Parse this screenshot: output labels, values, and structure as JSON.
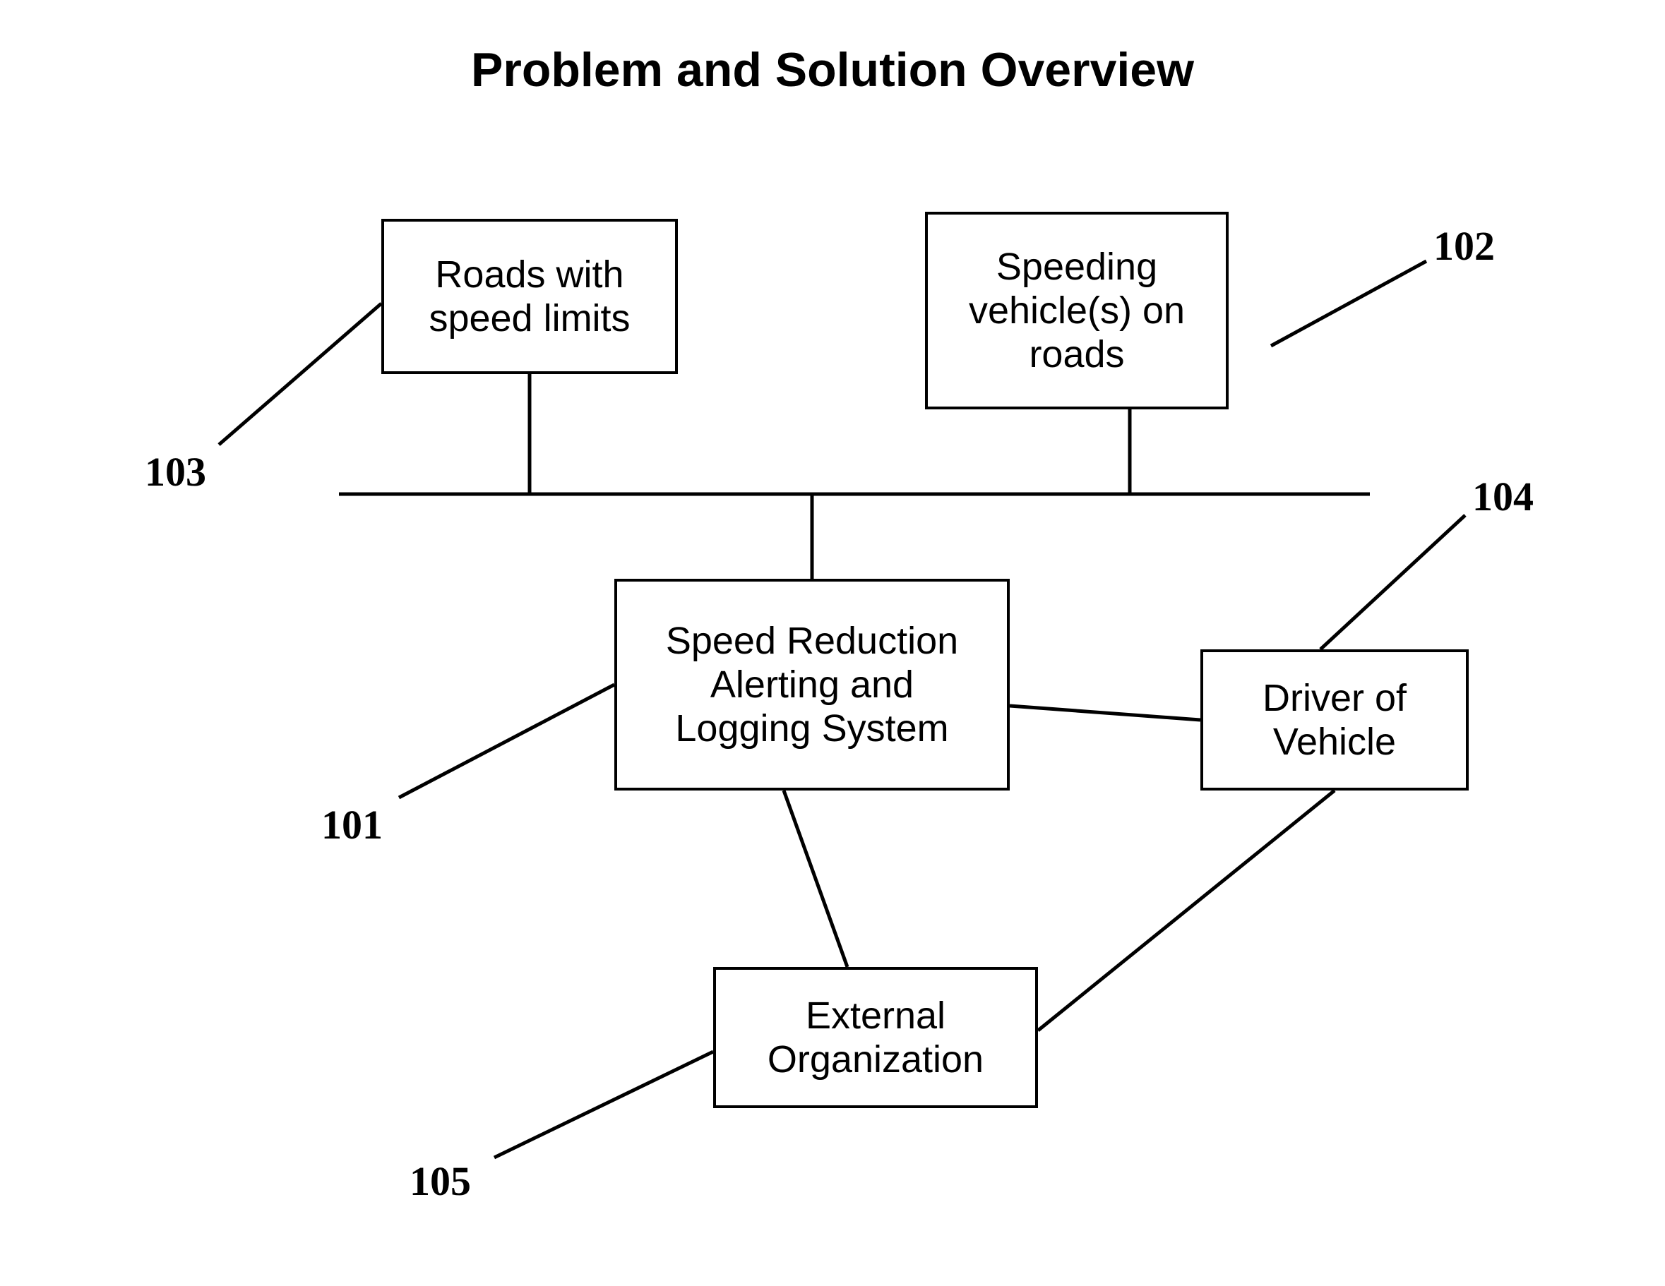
{
  "title": "Problem and Solution Overview",
  "nodes": {
    "roads": {
      "line1": "Roads with",
      "line2": "speed limits"
    },
    "speeding": {
      "line1": "Speeding",
      "line2": "vehicle(s) on",
      "line3": "roads"
    },
    "system": {
      "line1": "Speed Reduction",
      "line2": "Alerting and",
      "line3": "Logging System"
    },
    "driver": {
      "line1": "Driver of",
      "line2": "Vehicle"
    },
    "external": {
      "line1": "External",
      "line2": "Organization"
    }
  },
  "refs": {
    "r101": "101",
    "r102": "102",
    "r103": "103",
    "r104": "104",
    "r105": "105"
  },
  "fontSizes": {
    "title": 68,
    "node": 54,
    "ref": 58
  }
}
